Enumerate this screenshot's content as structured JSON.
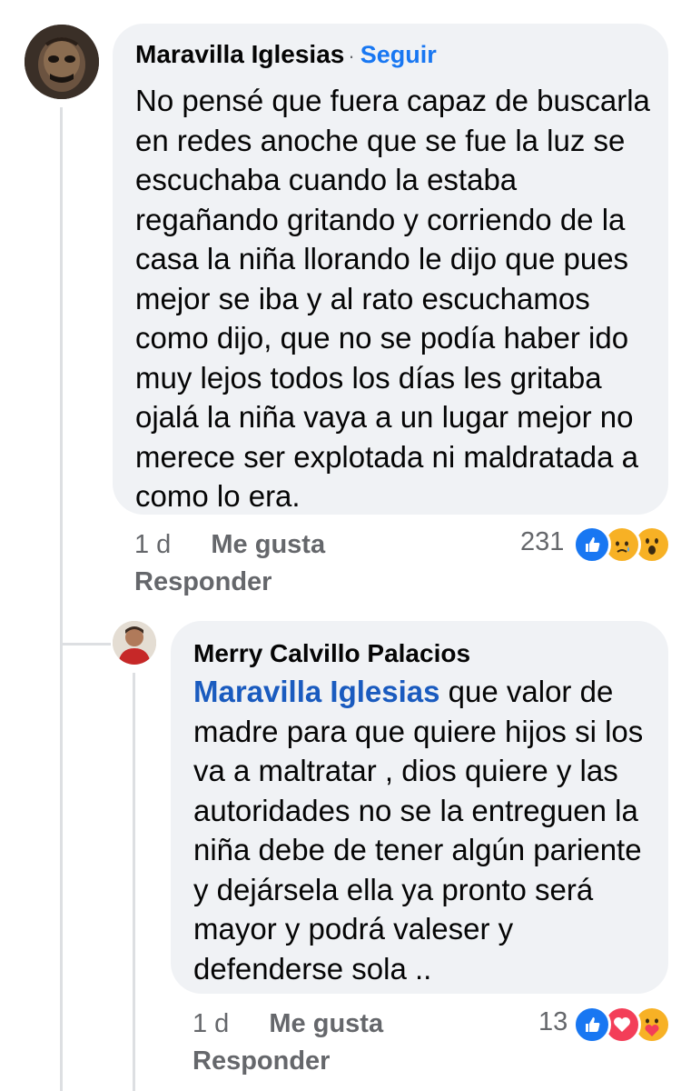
{
  "comment": {
    "author": "Maravilla Iglesias",
    "separator": "·",
    "follow_label": "Seguir",
    "text": "No pensé que fuera capaz de buscarla en redes anoche que se fue la luz se escuchaba cuando la estaba regañando gritando y corriendo de la casa la niña llorando le dijo que pues mejor se iba y al rato escuchamos como dijo, que no se podía haber ido muy lejos todos los días les gritaba ojalá la niña vaya a un lugar mejor no merece ser explotada ni maldratada a como lo era.",
    "time": "1 d",
    "like_label": "Me gusta",
    "reply_label": "Responder",
    "reaction_count": "231",
    "reactions": [
      "like-icon",
      "sad-icon",
      "wow-icon"
    ]
  },
  "reply": {
    "author": "Merry Calvillo Palacios",
    "mention": "Maravilla Iglesias",
    "text": " que valor de madre para que quiere hijos si los va a maltratar , dios quiere y las autoridades no se la entreguen la niña debe de tener algún pariente y dejársela ella ya pronto será mayor y podrá valeser y defenderse sola ..",
    "time": "1 d",
    "like_label": "Me gusta",
    "reply_label": "Responder",
    "reaction_count": "13",
    "reactions": [
      "like-icon",
      "love-icon",
      "care-icon"
    ]
  },
  "colors": {
    "accent": "#1877f2",
    "bubble": "#f0f2f5",
    "meta": "#65676b"
  }
}
